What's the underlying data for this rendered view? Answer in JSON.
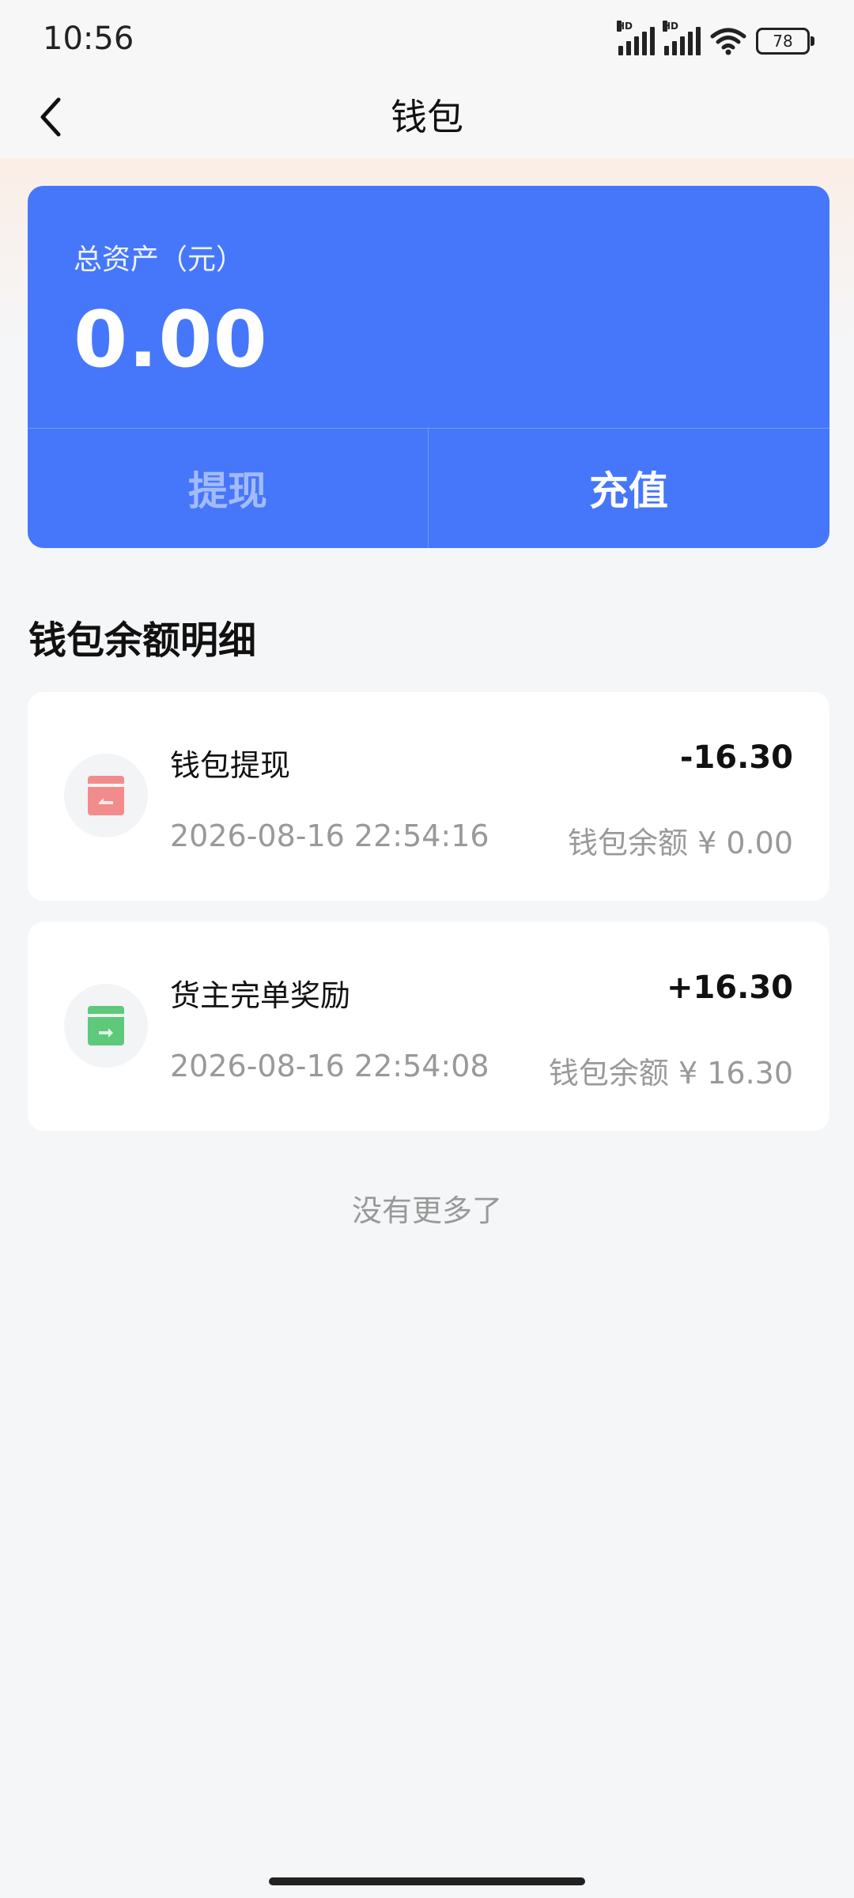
{
  "status_bar": {
    "time": "10:56",
    "signal_1_label": "HD",
    "signal_2_label": "HD",
    "wifi_icon": "wifi-icon",
    "battery_level": "78"
  },
  "nav": {
    "title": "钱包",
    "back_icon": "chevron-left-icon"
  },
  "wallet": {
    "asset_label": "总资产（元）",
    "asset_value": "0.00",
    "withdraw_label": "提现",
    "recharge_label": "充值",
    "card_color": "#4677fa"
  },
  "section": {
    "title": "钱包余额明细"
  },
  "records": [
    {
      "title": "钱包提现",
      "amount": "-16.30",
      "time": "2026-08-16 22:54:16",
      "balance": "钱包余额 ¥ 0.00",
      "icon": "withdraw-card-icon",
      "icon_color": "#f28c8c"
    },
    {
      "title": "货主完单奖励",
      "amount": "+16.30",
      "time": "2026-08-16 22:54:08",
      "balance": "钱包余额 ¥ 16.30",
      "icon": "reward-card-icon",
      "icon_color": "#5ec97b"
    }
  ],
  "footer": {
    "no_more": "没有更多了"
  }
}
